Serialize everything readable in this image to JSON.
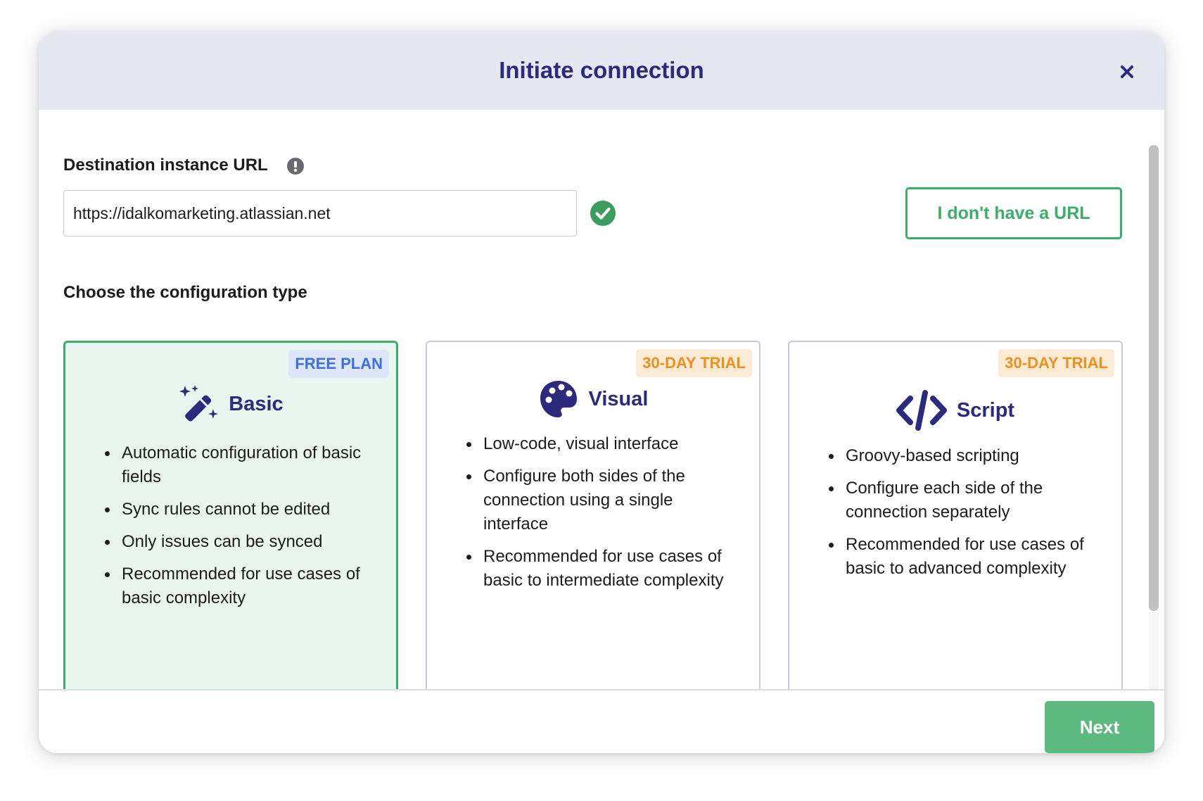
{
  "modal": {
    "title": "Initiate connection",
    "close_icon": "close-icon"
  },
  "url_section": {
    "label": "Destination instance URL",
    "info_icon": "info-icon",
    "input_value": "https://idalkomarketing.atlassian.net",
    "valid_icon": "check-circle-icon",
    "no_url_button": "I don't have a URL"
  },
  "config_section": {
    "label": "Choose the configuration type",
    "cards": [
      {
        "badge": "FREE PLAN",
        "icon": "magic-wand-icon",
        "title": "Basic",
        "selected": true,
        "items": [
          "Automatic configuration of basic fields",
          "Sync rules cannot be edited",
          "Only issues can be synced",
          "Recommended for use cases of basic complexity"
        ]
      },
      {
        "badge": "30-DAY TRIAL",
        "icon": "palette-icon",
        "title": "Visual",
        "selected": false,
        "items": [
          "Low-code, visual interface",
          "Configure both sides of the connection using a single interface",
          "Recommended for use cases of basic to intermediate complexity"
        ]
      },
      {
        "badge": "30-DAY TRIAL",
        "icon": "code-icon",
        "title": "Script",
        "selected": false,
        "items": [
          "Groovy-based scripting",
          "Configure each side of the connection separately",
          "Recommended for use cases of basic to advanced complexity"
        ]
      }
    ]
  },
  "footer": {
    "next_button": "Next"
  },
  "colors": {
    "accent_green": "#3cae6a",
    "next_green": "#5cba80",
    "title_navy": "#2b2a7d",
    "header_bg": "#e6e8f1",
    "free_badge_text": "#3d6fe0",
    "trial_badge_text": "#ec9120"
  }
}
